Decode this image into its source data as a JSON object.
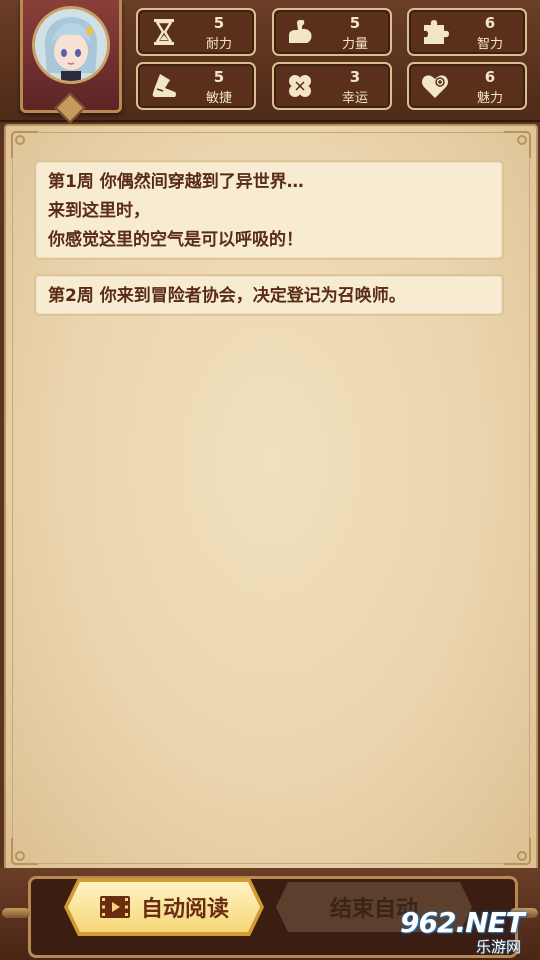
{
  "stats": [
    {
      "icon": "hourglass-icon",
      "value": "5",
      "label": "耐力"
    },
    {
      "icon": "flexed-arm-icon",
      "value": "5",
      "label": "力量"
    },
    {
      "icon": "puzzle-piece-icon",
      "value": "6",
      "label": "智力"
    },
    {
      "icon": "boot-icon",
      "value": "5",
      "label": "敏捷"
    },
    {
      "icon": "clover-icon",
      "value": "3",
      "label": "幸运"
    },
    {
      "icon": "heart-plus-icon",
      "value": "6",
      "label": "魅力"
    }
  ],
  "log": {
    "entry1": {
      "line1": "第1周 你偶然间穿越到了异世界…",
      "line2": "来到这里时，",
      "line3": "你感觉这里的空气是可以呼吸的！"
    },
    "entry2": {
      "line1": "第2周 你来到冒险者协会，决定登记为召唤师。"
    }
  },
  "buttons": {
    "auto_read": "自动阅读",
    "end_auto": "结束自动"
  },
  "watermark": {
    "brand": "962.NET",
    "sub": "乐游网"
  },
  "colors": {
    "frame_brown": "#5a3420",
    "parchment": "#ebd5ae",
    "text_brown": "#5a2c16",
    "button_gold": "#f6d678"
  }
}
